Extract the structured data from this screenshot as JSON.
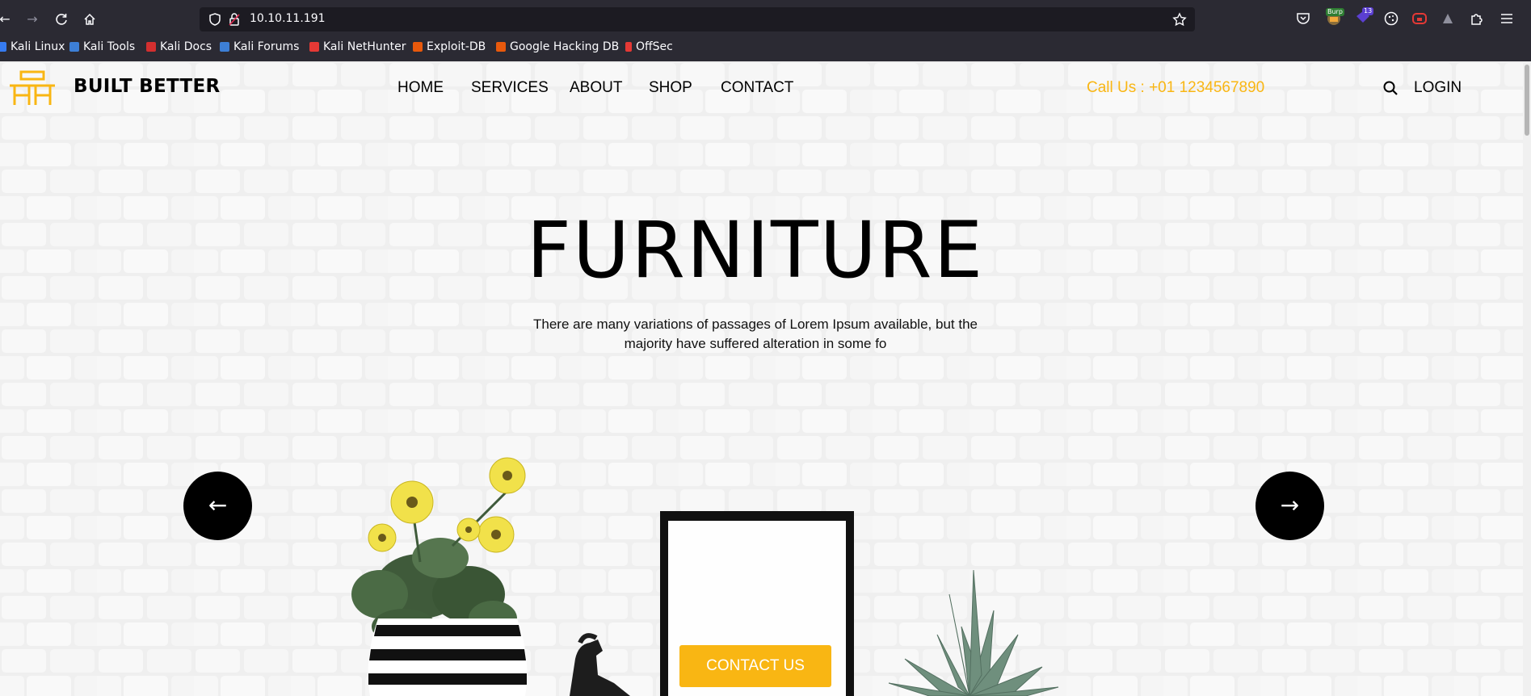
{
  "browser": {
    "url": "10.10.11.191",
    "bookmarks": [
      {
        "label": "Kali Linux",
        "color": "#367bf0"
      },
      {
        "label": "Kali Tools",
        "color": "#e53935"
      },
      {
        "label": "Kali Docs",
        "color": "#d32f2f"
      },
      {
        "label": "Kali Forums",
        "color": "#3d7fd6"
      },
      {
        "label": "Kali NetHunter",
        "color": "#e53935"
      },
      {
        "label": "Exploit-DB",
        "color": "#e8590c"
      },
      {
        "label": "Google Hacking DB",
        "color": "#e8590c"
      },
      {
        "label": "OffSec",
        "color": "#e53935"
      }
    ],
    "badges": {
      "burp": "Burp",
      "count": "13"
    }
  },
  "site": {
    "brand": "BUILT BETTER",
    "nav": [
      "HOME",
      "SERVICES",
      "ABOUT",
      "SHOP",
      "CONTACT"
    ],
    "call": "Call Us : +01 1234567890",
    "login": "LOGIN",
    "accent": "#f9b613"
  },
  "hero": {
    "title": "FURNITURE",
    "text": "There are many variations of passages of Lorem Ipsum available, but the majority have suffered alteration in some fo",
    "prev_arrow": "←",
    "next_arrow": "→",
    "cta": "CONTACT US"
  }
}
